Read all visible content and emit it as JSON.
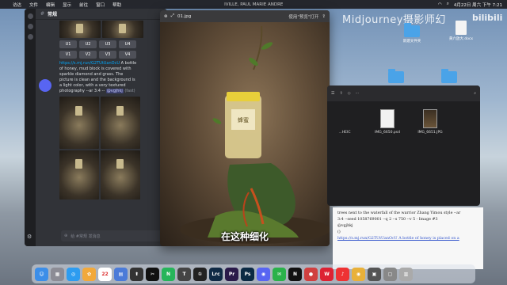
{
  "menubar": {
    "apple": "",
    "items": [
      "访达",
      "文件",
      "编辑",
      "显示",
      "前往",
      "窗口",
      "帮助"
    ],
    "center_text": "IVILLE, PAUL MARIE ANDRE",
    "clock": "4月22日 周六 下午 7:21"
  },
  "watermark": {
    "text": "Midjourney摄影师幻",
    "logo": "bilibili"
  },
  "desktop": {
    "icons": [
      {
        "label": "新建文件夹",
        "kind": "folder"
      },
      {
        "label": "黄六放大.docx",
        "kind": "doc"
      }
    ]
  },
  "discord": {
    "channel": "常规",
    "upscale_buttons": [
      "U1",
      "U2",
      "U3",
      "U4"
    ],
    "variation_buttons": [
      "V1",
      "V2",
      "V3",
      "V4"
    ],
    "reroll_icon": "refresh-icon",
    "message": {
      "link": "https://s.mj.run/G2TUtUanOcU",
      "text": " A bottle of honey, mud block is covered with sparkle diamond and grass. The picture is clean and the background is a light color, with a very textured photography --ar 3:4 --",
      "mention": "@vgjhkj",
      "speed": "(fast)"
    },
    "composer_placeholder": "给 #常规 发消息"
  },
  "preview": {
    "filename": "01.jpg",
    "open_with": "使用\"预览\"打开",
    "subtitle": "在这种细化",
    "jar_label": "蜂蜜"
  },
  "finder": {
    "files": [
      {
        "name": "...HEIC",
        "kind": "partial"
      },
      {
        "name": "IMG_6650.psd",
        "kind": "light"
      },
      {
        "name": "IMG_6651.JPG",
        "kind": "dark"
      }
    ]
  },
  "document": {
    "lines": [
      "trees next to the waterfall of the warrior Zhang Yimou style --ar",
      "3:4 --seed 1058769001 --q 2 --s 750 --v 5 - Image #3",
      "@vgjhkj",
      "()",
      "https://s.mj.run/G2TUtUanOcU A bottle of honey is placed on a"
    ]
  },
  "dock": {
    "apps": [
      {
        "name": "finder",
        "glyph": "☺",
        "color": "#3c8ee8"
      },
      {
        "name": "launchpad",
        "glyph": "▦",
        "color": "#8c8c95"
      },
      {
        "name": "safari",
        "glyph": "◎",
        "color": "#2d9cf0"
      },
      {
        "name": "photos",
        "glyph": "✿",
        "color": "#f2a93b"
      },
      {
        "name": "calendar",
        "glyph": "22",
        "color": "#ffffff"
      },
      {
        "name": "finder2",
        "glyph": "▤",
        "color": "#4b7bd8"
      },
      {
        "name": "stocks",
        "glyph": "⬆",
        "color": "#333"
      },
      {
        "name": "capcut",
        "glyph": "✂",
        "color": "#111"
      },
      {
        "name": "notes",
        "glyph": "N",
        "color": "#26b55a"
      },
      {
        "name": "typora",
        "glyph": "T",
        "color": "#444"
      },
      {
        "name": "davinci",
        "glyph": "①",
        "color": "#222"
      },
      {
        "name": "lightroom",
        "glyph": "Lrc",
        "color": "#0f2a45"
      },
      {
        "name": "premiere",
        "glyph": "Pr",
        "color": "#2a1a4a"
      },
      {
        "name": "photoshop",
        "glyph": "Ps",
        "color": "#0b2a44"
      },
      {
        "name": "discord",
        "glyph": "◉",
        "color": "#5865f2"
      },
      {
        "name": "wechat",
        "glyph": "✉",
        "color": "#2ab24a"
      },
      {
        "name": "notion",
        "glyph": "N",
        "color": "#111"
      },
      {
        "name": "other",
        "glyph": "●",
        "color": "#d04040"
      },
      {
        "name": "wps",
        "glyph": "W",
        "color": "#d23"
      },
      {
        "name": "netease",
        "glyph": "♪",
        "color": "#e33"
      },
      {
        "name": "chrome",
        "glyph": "◉",
        "color": "#e9b13a"
      },
      {
        "name": "gallery",
        "glyph": "▣",
        "color": "#555"
      },
      {
        "name": "app",
        "glyph": "▢",
        "color": "#888"
      },
      {
        "name": "trash",
        "glyph": "▥",
        "color": "#aaa"
      }
    ]
  }
}
